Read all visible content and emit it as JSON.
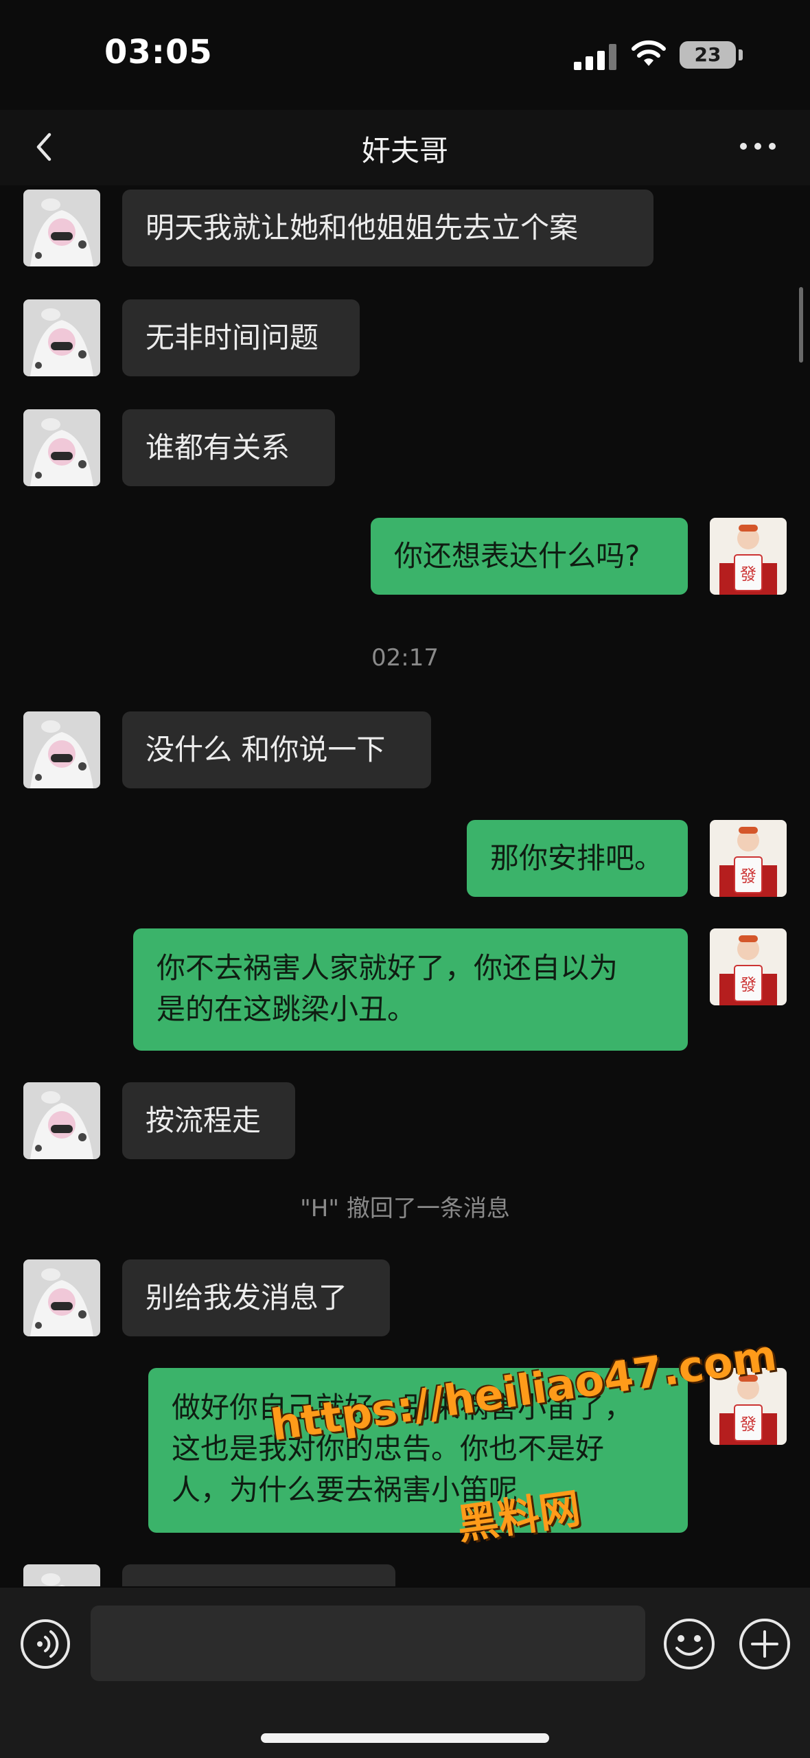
{
  "status_bar": {
    "time": "03:05",
    "battery": "23"
  },
  "nav": {
    "title": "奸夫哥"
  },
  "messages": [
    {
      "side": "in",
      "text": "明天我就让她和他姐姐先去立个案"
    },
    {
      "side": "in",
      "text": "无非时间问题"
    },
    {
      "side": "in",
      "text": "谁都有关系"
    },
    {
      "side": "out",
      "text": "你还想表达什么吗?"
    },
    {
      "side": "system",
      "text": "02:17"
    },
    {
      "side": "in",
      "text": "没什么 和你说一下"
    },
    {
      "side": "out",
      "text": "那你安排吧。"
    },
    {
      "side": "out",
      "text": "你不去祸害人家就好了，你还自以为\n是的在这跳梁小丑。"
    },
    {
      "side": "in",
      "text": "按流程走"
    },
    {
      "side": "system",
      "text": "\"H\" 撤回了一条消息"
    },
    {
      "side": "in",
      "text": "别给我发消息了"
    },
    {
      "side": "out",
      "text": "做好你自己就好，别来祸害小笛了，\n这也是我对你的忠告。你也不是好\n人，为什么要去祸害小笛呢"
    }
  ],
  "watermark": {
    "url": "https://heiliao47.com",
    "name": "黑料网"
  },
  "input": {
    "value": ""
  },
  "colors": {
    "outgoing_bubble": "#3bb36a",
    "incoming_bubble": "#2b2b2b",
    "background": "#0c0c0c"
  }
}
